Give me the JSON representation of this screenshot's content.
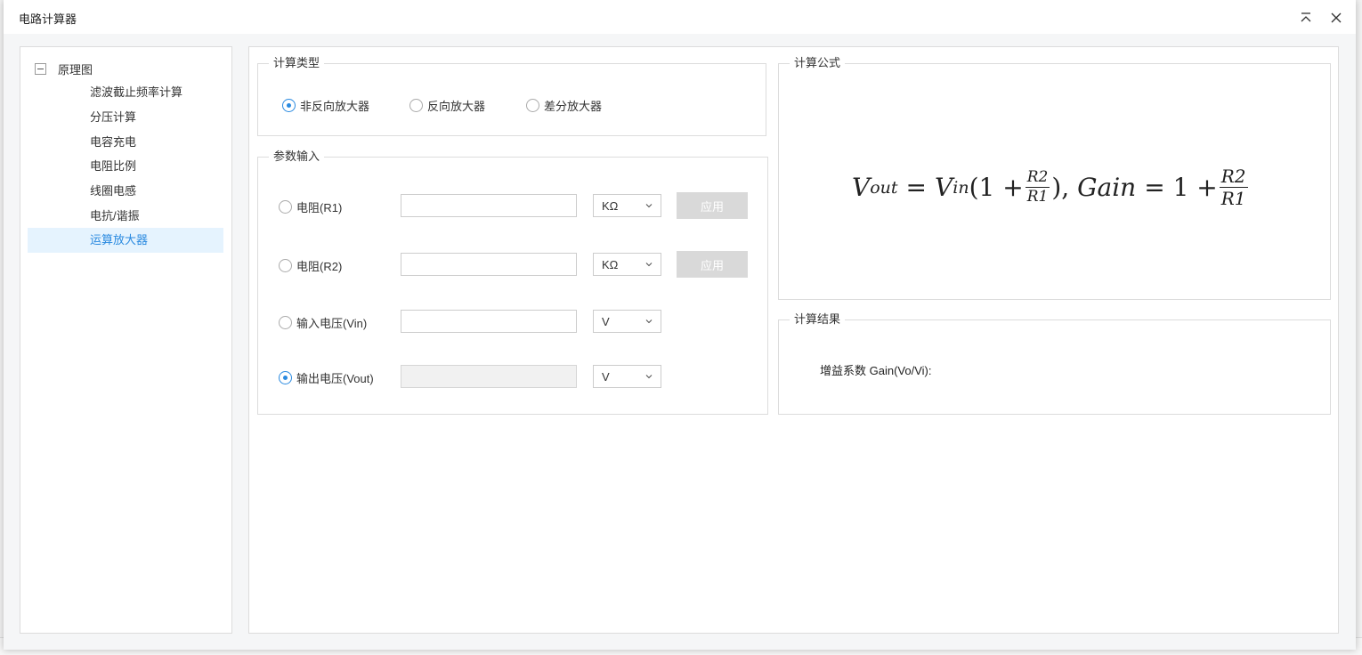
{
  "dialog": {
    "title": "电路计算器"
  },
  "tree": {
    "root_label": "原理图",
    "items": [
      {
        "label": "滤波截止频率计算",
        "active": false
      },
      {
        "label": "分压计算",
        "active": false
      },
      {
        "label": "电容充电",
        "active": false
      },
      {
        "label": "电阻比例",
        "active": false
      },
      {
        "label": "线圈电感",
        "active": false
      },
      {
        "label": "电抗/谐振",
        "active": false
      },
      {
        "label": "运算放大器",
        "active": true
      }
    ]
  },
  "calc_type": {
    "title": "计算类型",
    "options": [
      {
        "label": "非反向放大器",
        "checked": true
      },
      {
        "label": "反向放大器",
        "checked": false
      },
      {
        "label": "差分放大器",
        "checked": false
      }
    ]
  },
  "params": {
    "title": "参数输入",
    "apply_label": "应用",
    "rows": [
      {
        "label": "电阻(R1)",
        "checked": false,
        "value": "",
        "unit": "KΩ",
        "has_apply": true,
        "disabled": false
      },
      {
        "label": "电阻(R2)",
        "checked": false,
        "value": "",
        "unit": "KΩ",
        "has_apply": true,
        "disabled": false
      },
      {
        "label": "输入电压(Vin)",
        "checked": false,
        "value": "",
        "unit": "V",
        "has_apply": false,
        "disabled": false
      },
      {
        "label": "输出电压(Vout)",
        "checked": true,
        "value": "",
        "unit": "V",
        "has_apply": false,
        "disabled": true
      }
    ]
  },
  "formula": {
    "title": "计算公式",
    "v": "V",
    "out_sub": "out",
    "eq": "=",
    "in_sub": "in",
    "open": "(1 +",
    "r2": "R2",
    "r1": "R1",
    "close": "),",
    "gain": "Gain",
    "eq2": "= 1 +"
  },
  "result": {
    "title": "计算结果",
    "gain_label": "增益系数 Gain(Vo/Vi):"
  },
  "colors": {
    "accent": "#2a8ae0",
    "active_bg": "#e5f3fe",
    "disabled_button": "#d9d9d9"
  }
}
